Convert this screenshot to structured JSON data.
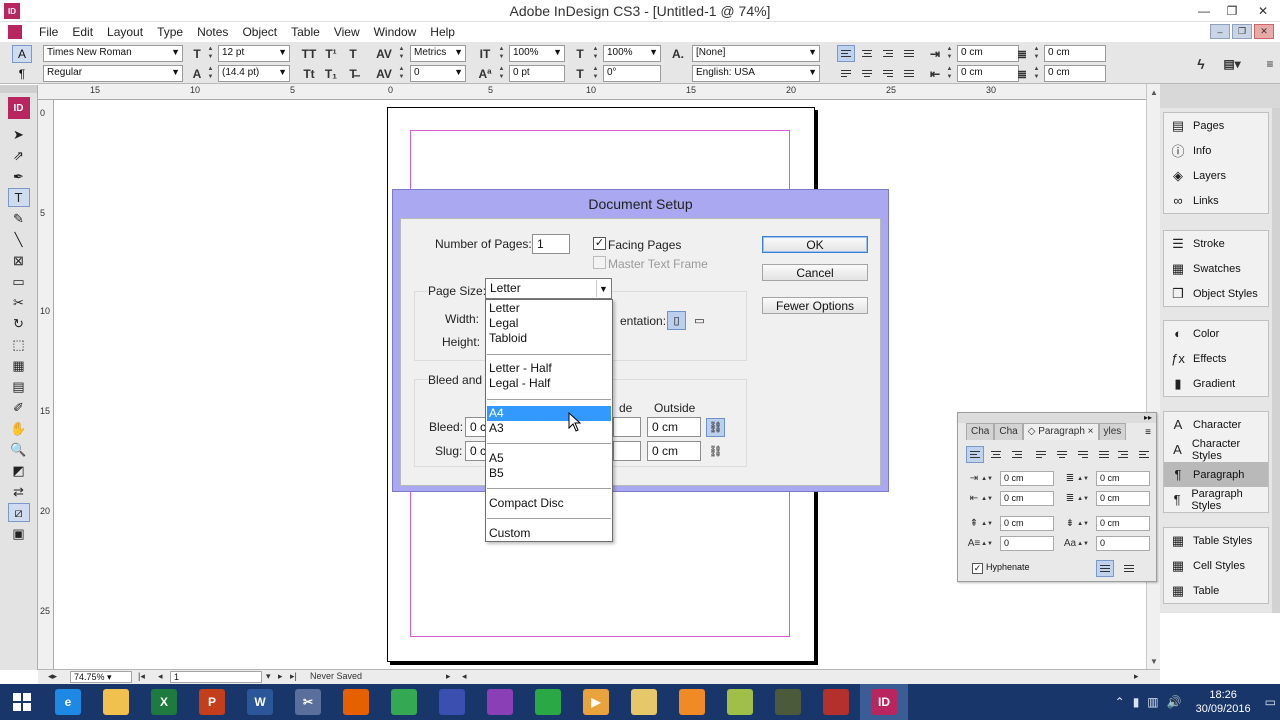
{
  "window": {
    "title": "Adobe InDesign CS3 - [Untitled-1 @ 74%]",
    "logo_text": "ID"
  },
  "menu": [
    "File",
    "Edit",
    "Layout",
    "Type",
    "Notes",
    "Object",
    "Table",
    "View",
    "Window",
    "Help"
  ],
  "control_bar": {
    "font_family": "Times New Roman",
    "font_style": "Regular",
    "font_size": "12 pt",
    "leading": "(14.4 pt)",
    "kerning": "Metrics",
    "tracking": "0",
    "vertical_scale": "100%",
    "baseline_shift": "0 pt",
    "horizontal_scale": "100%",
    "skew": "0°",
    "char_style": "[None]",
    "language": "English: USA",
    "left_indent": "0 cm",
    "first_line_indent": "0 cm",
    "right_indent": "0 cm",
    "last_line_indent": "0 cm"
  },
  "rulers": {
    "top": [
      "15",
      "10",
      "5",
      "0",
      "5",
      "10",
      "15",
      "20",
      "25",
      "30"
    ],
    "left": [
      "0",
      "5",
      "10",
      "15",
      "20",
      "25"
    ]
  },
  "status_bar": {
    "zoom": "74.75%",
    "page": "1",
    "save_status": "Never Saved"
  },
  "dialog": {
    "title": "Document Setup",
    "num_pages_label": "Number of Pages:",
    "num_pages_value": "1",
    "facing_pages_label": "Facing Pages",
    "facing_pages_checked": true,
    "master_text_frame_label": "Master Text Frame",
    "page_size_label": "Page Size:",
    "page_size_value": "Letter",
    "width_label": "Width:",
    "height_label": "Height:",
    "orientation_label": "entation:",
    "bleed_slug_label": "Bleed and S",
    "inside_label": "de",
    "outside_label": "Outside",
    "bleed_label": "Bleed:",
    "slug_label": "Slug:",
    "bleed_left_value": "0 c",
    "slug_left_value": "0 c",
    "bleed_outside_value": "0 cm",
    "slug_outside_value": "0 cm",
    "ok_label": "OK",
    "cancel_label": "Cancel",
    "fewer_options_label": "Fewer Options"
  },
  "page_size_options": {
    "groups": [
      [
        "Letter",
        "Legal",
        "Tabloid"
      ],
      [
        "Letter - Half",
        "Legal - Half"
      ],
      [
        "A4",
        "A3"
      ],
      [
        "A5",
        "B5"
      ],
      [
        "Compact Disc"
      ],
      [
        "Custom"
      ]
    ],
    "highlighted": "A4"
  },
  "dock_panels": {
    "groups": [
      [
        {
          "label": "Pages",
          "icon": "pages-icon"
        },
        {
          "label": "Info",
          "icon": "info-icon"
        },
        {
          "label": "Layers",
          "icon": "layers-icon"
        },
        {
          "label": "Links",
          "icon": "links-icon"
        }
      ],
      [
        {
          "label": "Stroke",
          "icon": "stroke-icon"
        },
        {
          "label": "Swatches",
          "icon": "swatches-icon"
        },
        {
          "label": "Object Styles",
          "icon": "object-styles-icon"
        }
      ],
      [
        {
          "label": "Color",
          "icon": "color-icon"
        },
        {
          "label": "Effects",
          "icon": "effects-icon"
        },
        {
          "label": "Gradient",
          "icon": "gradient-icon"
        }
      ],
      [
        {
          "label": "Character",
          "icon": "character-icon"
        },
        {
          "label": "Character Styles",
          "icon": "character-styles-icon"
        },
        {
          "label": "Paragraph",
          "icon": "paragraph-icon"
        },
        {
          "label": "Paragraph Styles",
          "icon": "paragraph-styles-icon"
        }
      ],
      [
        {
          "label": "Table Styles",
          "icon": "table-styles-icon"
        },
        {
          "label": "Cell Styles",
          "icon": "cell-styles-icon"
        },
        {
          "label": "Table",
          "icon": "table-icon"
        }
      ]
    ],
    "selected": "Paragraph"
  },
  "paragraph_panel": {
    "tabs": [
      "Cha",
      "Cha",
      "◇ Paragraph ×",
      "yles"
    ],
    "left_indent": "0 cm",
    "right_indent": "0 cm",
    "first_line_indent": "0 cm",
    "last_line_indent": "0 cm",
    "space_before": "0 cm",
    "space_after": "0 cm",
    "drop_cap_lines": "0",
    "drop_cap_chars": "0",
    "hyphenate_label": "Hyphenate",
    "hyphenate_checked": true
  },
  "taskbar": {
    "time": "18:26",
    "date": "30/09/2016",
    "apps": [
      {
        "name": "internet-explorer",
        "letter": "e",
        "color": "#1e88e5"
      },
      {
        "name": "file-explorer",
        "letter": "",
        "color": "#f2c04e"
      },
      {
        "name": "excel",
        "letter": "X",
        "color": "#1f7a3f"
      },
      {
        "name": "powerpoint",
        "letter": "P",
        "color": "#c43e1c"
      },
      {
        "name": "word",
        "letter": "W",
        "color": "#2b579a"
      },
      {
        "name": "snipping-tool",
        "letter": "✂",
        "color": "#5a6f9c"
      },
      {
        "name": "firefox",
        "letter": "",
        "color": "#e66000"
      },
      {
        "name": "chrome",
        "letter": "",
        "color": "#34a853"
      },
      {
        "name": "app-globe",
        "letter": "",
        "color": "#3a4fb0"
      },
      {
        "name": "app-sphere",
        "letter": "",
        "color": "#8a3fb7"
      },
      {
        "name": "store",
        "letter": "",
        "color": "#2aa845"
      },
      {
        "name": "media",
        "letter": "▶",
        "color": "#e8a33d"
      },
      {
        "name": "folder",
        "letter": "",
        "color": "#e6c76a"
      },
      {
        "name": "app-orange",
        "letter": "",
        "color": "#f08a24"
      },
      {
        "name": "app-green",
        "letter": "",
        "color": "#9fbf48"
      },
      {
        "name": "app-camera",
        "letter": "",
        "color": "#4c5a3c"
      },
      {
        "name": "app-game",
        "letter": "",
        "color": "#b3302d"
      },
      {
        "name": "indesign",
        "letter": "ID",
        "color": "#b8255f"
      }
    ]
  },
  "colors": {
    "dialog_title_bg": "#a9a8f1",
    "margin_guide": "#d55fd6",
    "selection": "#3399ff",
    "taskbar": "#19366a",
    "brand": "#b8255f"
  }
}
